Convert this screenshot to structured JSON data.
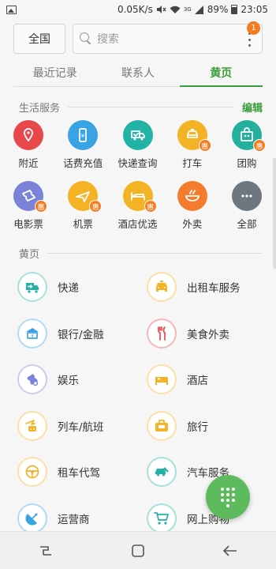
{
  "status_bar": {
    "speed": "0.05K/s",
    "net_type": "3G",
    "battery": "89%",
    "time": "23:05"
  },
  "search": {
    "scope": "全国",
    "placeholder": "搜索",
    "badge_count": "1"
  },
  "tabs": [
    {
      "label": "最近记录",
      "active": false
    },
    {
      "label": "联系人",
      "active": false
    },
    {
      "label": "黄页",
      "active": true
    }
  ],
  "life_services": {
    "title": "生活服务",
    "edit_label": "编辑",
    "hui_label": "惠",
    "items": [
      {
        "label": "附近",
        "icon": "location-pin-icon",
        "color": "#e8474c",
        "hui": false
      },
      {
        "label": "话费充值",
        "icon": "phone-topup-icon",
        "color": "#3aa3e3",
        "hui": false
      },
      {
        "label": "快递查询",
        "icon": "delivery-truck-icon",
        "color": "#23b3a6",
        "hui": false
      },
      {
        "label": "打车",
        "icon": "taxi-icon",
        "color": "#f4b324",
        "hui": true
      },
      {
        "label": "团购",
        "icon": "group-buy-icon",
        "color": "#25b09e",
        "hui": true
      },
      {
        "label": "电影票",
        "icon": "movie-ticket-icon",
        "color": "#7b83d8",
        "hui": true
      },
      {
        "label": "机票",
        "icon": "flight-ticket-icon",
        "color": "#f4b324",
        "hui": true
      },
      {
        "label": "酒店优选",
        "icon": "hotel-bed-icon",
        "color": "#f4b324",
        "hui": true
      },
      {
        "label": "外卖",
        "icon": "takeout-bowl-icon",
        "color": "#f57c2c",
        "hui": false
      },
      {
        "label": "全部",
        "icon": "more-dots-icon",
        "color": "#6e7780",
        "hui": false
      }
    ]
  },
  "yellow_pages": {
    "title": "黄页",
    "items": [
      {
        "label": "快递",
        "icon": "express-delivery-icon",
        "color": "#23b3a6"
      },
      {
        "label": "出租车服务",
        "icon": "taxi-service-icon",
        "color": "#f4b324"
      },
      {
        "label": "银行/金融",
        "icon": "bank-icon",
        "color": "#3aa3e3"
      },
      {
        "label": "美食外卖",
        "icon": "food-icon",
        "color": "#e8474c"
      },
      {
        "label": "娱乐",
        "icon": "entertainment-ticket-icon",
        "color": "#7b83d8"
      },
      {
        "label": "酒店",
        "icon": "hotel-icon",
        "color": "#f4b324"
      },
      {
        "label": "列车/航班",
        "icon": "train-flight-icon",
        "color": "#f4b324"
      },
      {
        "label": "旅行",
        "icon": "travel-suitcase-icon",
        "color": "#f4b324"
      },
      {
        "label": "租车代驾",
        "icon": "steering-wheel-icon",
        "color": "#f4b324"
      },
      {
        "label": "汽车服务",
        "icon": "car-service-icon",
        "color": "#23b3a6"
      },
      {
        "label": "运营商",
        "icon": "carrier-antenna-icon",
        "color": "#3aa3e3"
      },
      {
        "label": "网上购物",
        "icon": "shopping-cart-icon",
        "color": "#23b3a6"
      }
    ]
  }
}
